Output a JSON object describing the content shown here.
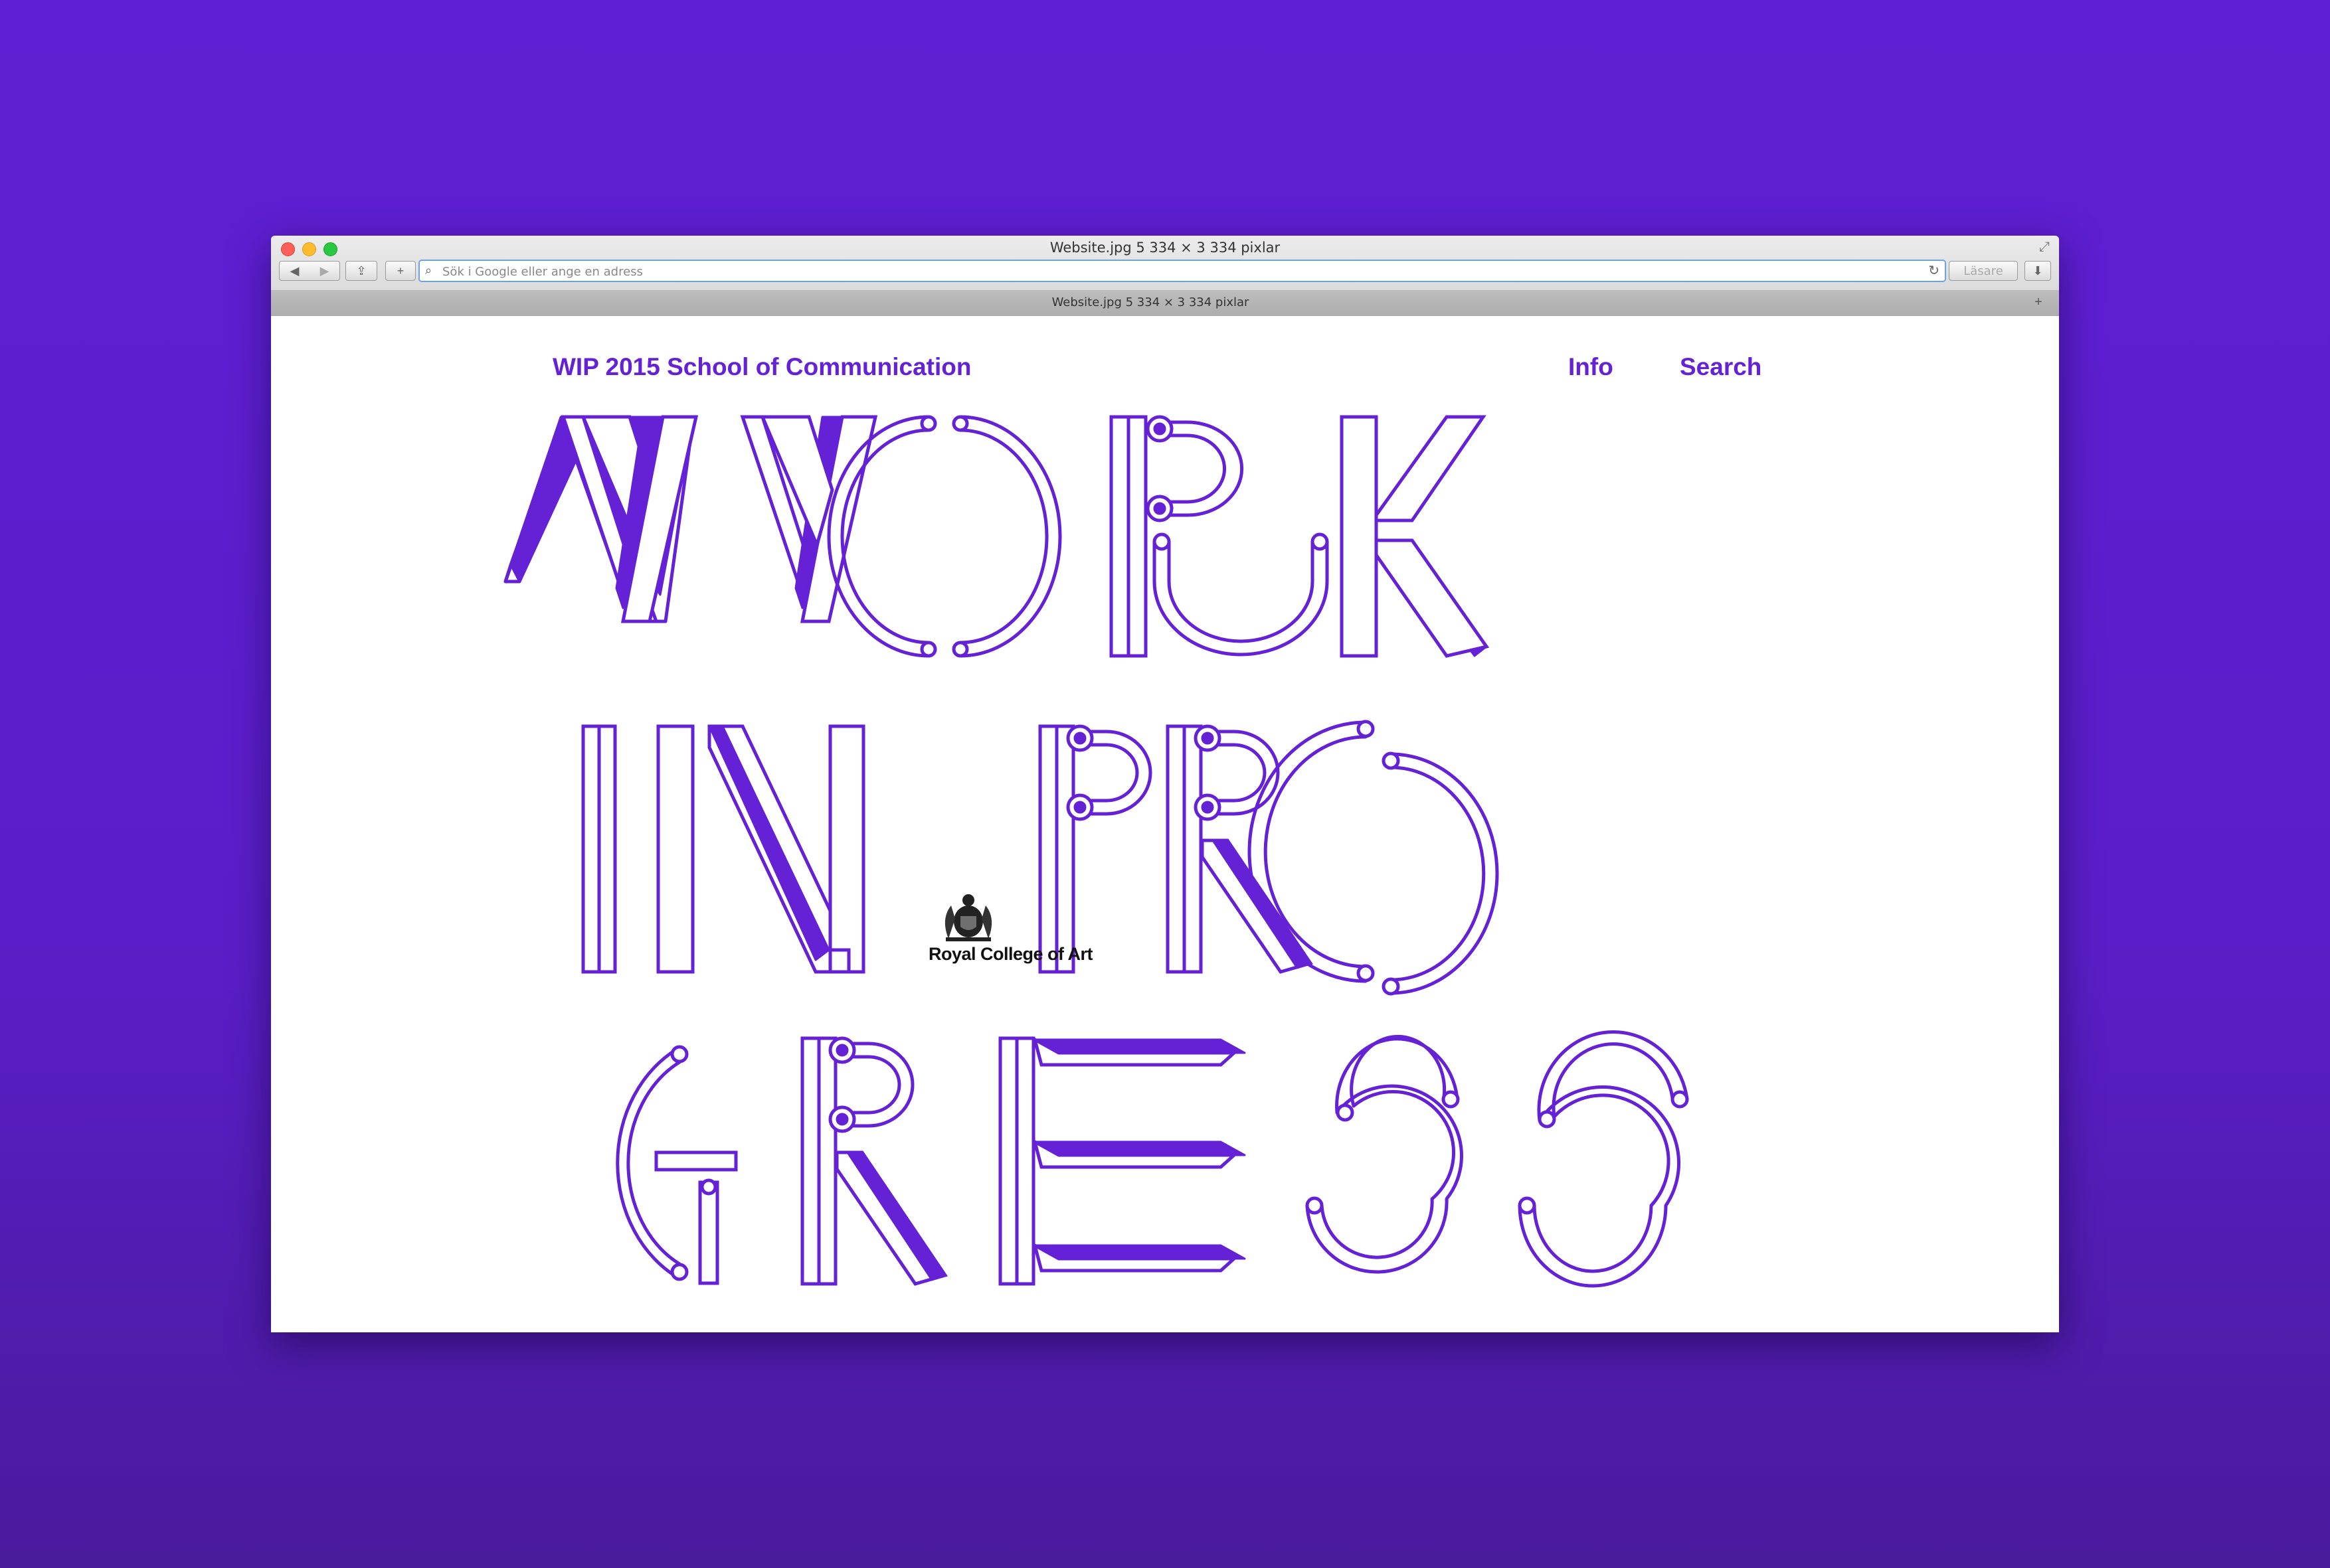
{
  "browser": {
    "window_title": "Website.jpg 5 334 × 3 334 pixlar",
    "address_placeholder": "Sök i Google eller ange en adress",
    "reader_label": "Läsare",
    "tab_title": "Website.jpg 5 334 × 3 334 pixlar"
  },
  "page": {
    "site_title": "WIP 2015 School of Communication",
    "nav": {
      "info": "Info",
      "search": "Search"
    },
    "headline_lines": [
      "WORK",
      "IN PRO",
      "GRESS"
    ],
    "logo_text": "Royal College of Art"
  },
  "colors": {
    "accent": "#6421d6",
    "background": "#5e1fd4",
    "page_background": "#ffffff"
  },
  "icons": [
    "back-icon",
    "forward-icon",
    "share-icon",
    "plus-icon",
    "search-icon",
    "reload-icon",
    "download-icon",
    "fullscreen-icon",
    "new-tab-icon",
    "royal-crest-icon"
  ]
}
